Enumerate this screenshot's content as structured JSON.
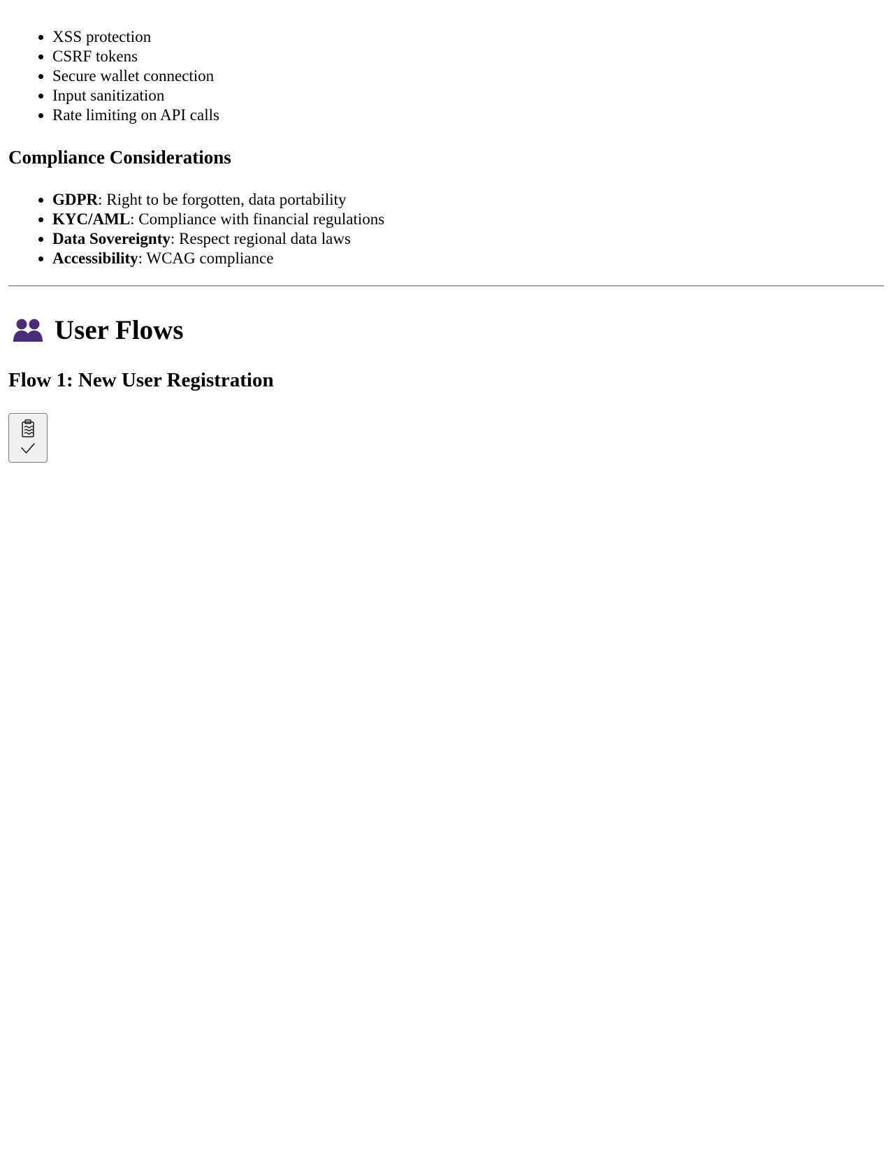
{
  "security_list": [
    "XSS protection",
    "CSRF tokens",
    "Secure wallet connection",
    "Input sanitization",
    "Rate limiting on API calls"
  ],
  "compliance": {
    "heading": "Compliance Considerations",
    "items": [
      {
        "term": "GDPR",
        "text": ": Right to be forgotten, data portability"
      },
      {
        "term": "KYC/AML",
        "text": ": Compliance with financial regulations"
      },
      {
        "term": "Data Sovereignty",
        "text": ": Respect regional data laws"
      },
      {
        "term": "Accessibility",
        "text": ": WCAG compliance"
      }
    ]
  },
  "user_flows": {
    "icon": "people-icon",
    "icon_color": "#4b2c7a",
    "heading": "User Flows",
    "flow1_heading": "Flow 1: New User Registration"
  },
  "clipboard_button": {
    "icons": [
      "clipboard-icon",
      "checkmark-icon"
    ]
  }
}
